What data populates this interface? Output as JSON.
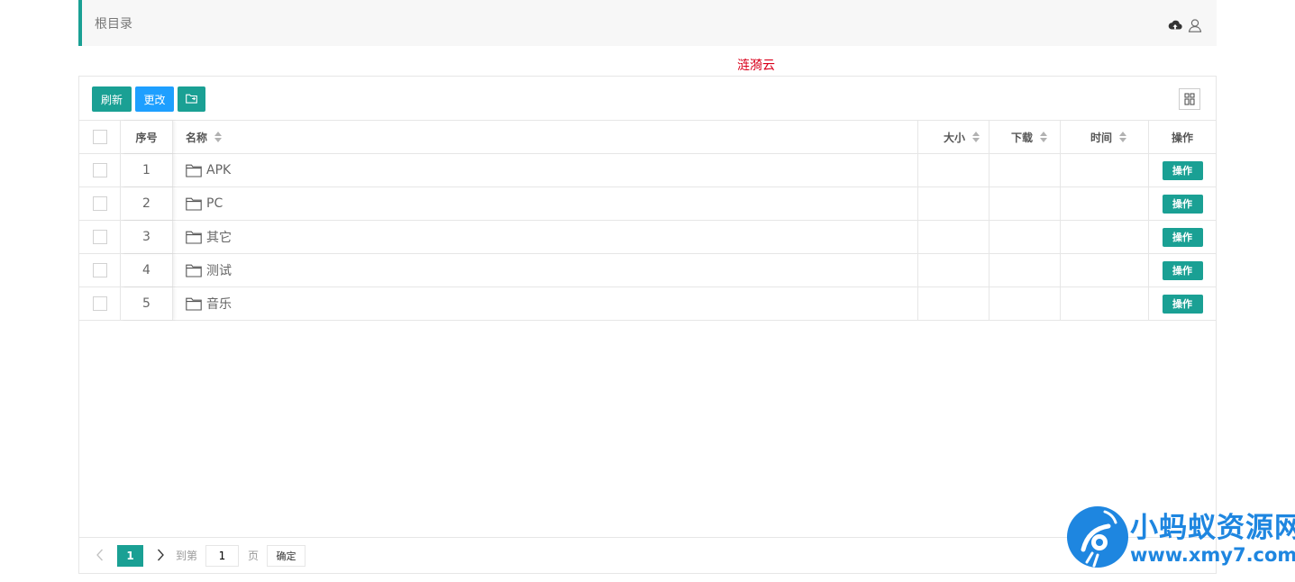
{
  "header": {
    "breadcrumb": "根目录",
    "icons": [
      "cloud-upload-icon",
      "user-icon"
    ]
  },
  "brand": {
    "text": "涟漪云",
    "color": "#d9001b"
  },
  "toolbar": {
    "refresh_label": "刷新",
    "change_label": "更改",
    "folder_icon": "folder-move-icon",
    "columns_icon": "columns-grid-icon"
  },
  "table": {
    "headers": {
      "index": "序号",
      "name": "名称",
      "size": "大小",
      "downloads": "下载",
      "time": "时间",
      "actions": "操作"
    },
    "rows": [
      {
        "index": "1",
        "name": "APK",
        "action": "操作"
      },
      {
        "index": "2",
        "name": "PC",
        "action": "操作"
      },
      {
        "index": "3",
        "name": "其它",
        "action": "操作"
      },
      {
        "index": "4",
        "name": "测试",
        "action": "操作"
      },
      {
        "index": "5",
        "name": "音乐",
        "action": "操作"
      }
    ]
  },
  "pager": {
    "current": "1",
    "goto_label": "到第",
    "input_value": "1",
    "page_label": "页",
    "confirm_label": "确定"
  },
  "watermark": {
    "title": "小蚂蚁资源网",
    "url": "www.xmy7.com"
  },
  "colors": {
    "accent": "#1aa094",
    "blue": "#1e9fff",
    "watermark": "#1e86e0"
  }
}
